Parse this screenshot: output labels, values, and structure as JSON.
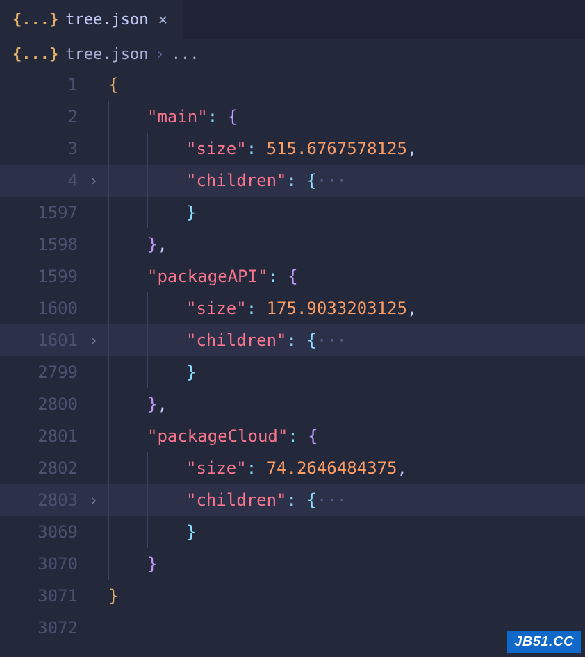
{
  "tab": {
    "label": "tree.json",
    "icon_text": "{...}"
  },
  "breadcrumb": {
    "file": "tree.json",
    "sep": "›",
    "rest": "...",
    "icon_text": "{...}"
  },
  "fold_glyph": "›",
  "watermark": "JB51.CC",
  "code_rows": [
    {
      "num": "1",
      "hl": false,
      "fold": false,
      "indent": 0,
      "tokens": [
        {
          "t": "{",
          "c": "brace-y"
        }
      ]
    },
    {
      "num": "2",
      "hl": false,
      "fold": false,
      "indent": 1,
      "tokens": [
        {
          "t": "\"main\"",
          "c": "key"
        },
        {
          "t": ":",
          "c": "punct"
        },
        {
          "t": " ",
          "c": "space"
        },
        {
          "t": "{",
          "c": "brace-m"
        }
      ]
    },
    {
      "num": "3",
      "hl": false,
      "fold": false,
      "indent": 2,
      "tokens": [
        {
          "t": "\"size\"",
          "c": "key"
        },
        {
          "t": ":",
          "c": "punct"
        },
        {
          "t": " ",
          "c": "space"
        },
        {
          "t": "515.6767578125",
          "c": "num"
        },
        {
          "t": ",",
          "c": "comma"
        }
      ]
    },
    {
      "num": "4",
      "hl": true,
      "fold": true,
      "indent": 2,
      "tokens": [
        {
          "t": "\"children\"",
          "c": "key"
        },
        {
          "t": ":",
          "c": "punct"
        },
        {
          "t": " ",
          "c": "space"
        },
        {
          "t": "{",
          "c": "brace-c"
        },
        {
          "t": "···",
          "c": "fold-dots"
        }
      ]
    },
    {
      "num": "1597",
      "hl": false,
      "fold": false,
      "indent": 2,
      "tokens": [
        {
          "t": "}",
          "c": "brace-c"
        }
      ]
    },
    {
      "num": "1598",
      "hl": false,
      "fold": false,
      "indent": 1,
      "tokens": [
        {
          "t": "}",
          "c": "brace-m"
        },
        {
          "t": ",",
          "c": "comma"
        }
      ]
    },
    {
      "num": "1599",
      "hl": false,
      "fold": false,
      "indent": 1,
      "tokens": [
        {
          "t": "\"packageAPI\"",
          "c": "key"
        },
        {
          "t": ":",
          "c": "punct"
        },
        {
          "t": " ",
          "c": "space"
        },
        {
          "t": "{",
          "c": "brace-m"
        }
      ]
    },
    {
      "num": "1600",
      "hl": false,
      "fold": false,
      "indent": 2,
      "tokens": [
        {
          "t": "\"size\"",
          "c": "key"
        },
        {
          "t": ":",
          "c": "punct"
        },
        {
          "t": " ",
          "c": "space"
        },
        {
          "t": "175.9033203125",
          "c": "num"
        },
        {
          "t": ",",
          "c": "comma"
        }
      ]
    },
    {
      "num": "1601",
      "hl": true,
      "fold": true,
      "indent": 2,
      "tokens": [
        {
          "t": "\"children\"",
          "c": "key"
        },
        {
          "t": ":",
          "c": "punct"
        },
        {
          "t": " ",
          "c": "space"
        },
        {
          "t": "{",
          "c": "brace-c"
        },
        {
          "t": "···",
          "c": "fold-dots"
        }
      ]
    },
    {
      "num": "2799",
      "hl": false,
      "fold": false,
      "indent": 2,
      "tokens": [
        {
          "t": "}",
          "c": "brace-c"
        }
      ]
    },
    {
      "num": "2800",
      "hl": false,
      "fold": false,
      "indent": 1,
      "tokens": [
        {
          "t": "}",
          "c": "brace-m"
        },
        {
          "t": ",",
          "c": "comma"
        }
      ]
    },
    {
      "num": "2801",
      "hl": false,
      "fold": false,
      "indent": 1,
      "tokens": [
        {
          "t": "\"packageCloud\"",
          "c": "key"
        },
        {
          "t": ":",
          "c": "punct"
        },
        {
          "t": " ",
          "c": "space"
        },
        {
          "t": "{",
          "c": "brace-m"
        }
      ]
    },
    {
      "num": "2802",
      "hl": false,
      "fold": false,
      "indent": 2,
      "tokens": [
        {
          "t": "\"size\"",
          "c": "key"
        },
        {
          "t": ":",
          "c": "punct"
        },
        {
          "t": " ",
          "c": "space"
        },
        {
          "t": "74.2646484375",
          "c": "num"
        },
        {
          "t": ",",
          "c": "comma"
        }
      ]
    },
    {
      "num": "2803",
      "hl": true,
      "fold": true,
      "indent": 2,
      "tokens": [
        {
          "t": "\"children\"",
          "c": "key"
        },
        {
          "t": ":",
          "c": "punct"
        },
        {
          "t": " ",
          "c": "space"
        },
        {
          "t": "{",
          "c": "brace-c"
        },
        {
          "t": "···",
          "c": "fold-dots"
        }
      ]
    },
    {
      "num": "3069",
      "hl": false,
      "fold": false,
      "indent": 2,
      "tokens": [
        {
          "t": "}",
          "c": "brace-c"
        }
      ]
    },
    {
      "num": "3070",
      "hl": false,
      "fold": false,
      "indent": 1,
      "tokens": [
        {
          "t": "}",
          "c": "brace-m"
        }
      ]
    },
    {
      "num": "3071",
      "hl": false,
      "fold": false,
      "indent": 0,
      "tokens": [
        {
          "t": "}",
          "c": "brace-y"
        }
      ]
    },
    {
      "num": "3072",
      "hl": false,
      "fold": false,
      "indent": 0,
      "tokens": []
    }
  ]
}
